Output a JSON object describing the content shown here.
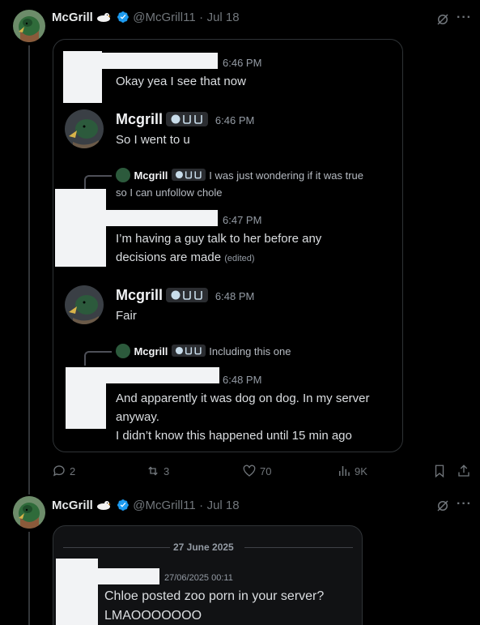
{
  "tweet1": {
    "author_name": "McGrill",
    "handle": "@McGrill11",
    "dot": "·",
    "date": "Jul 18",
    "stats": {
      "replies": "2",
      "reposts": "3",
      "likes": "70",
      "views": "9K"
    }
  },
  "discord": {
    "m1": {
      "time": "6:46 PM",
      "text": "Okay yea I see that now"
    },
    "m2": {
      "name": "Mcgrill",
      "time": "6:46 PM",
      "text": "So I went to u"
    },
    "r1": {
      "name": "Mcgrill",
      "text": "I was just wondering if it was true",
      "text2": "so I can unfollow chole"
    },
    "m3": {
      "time": "6:47 PM",
      "line1": "I’m having a guy talk to her before any",
      "line2": "decisions are made",
      "edited": "(edited)"
    },
    "m4": {
      "name": "Mcgrill",
      "time": "6:48 PM",
      "text": "Fair"
    },
    "r2": {
      "name": "Mcgrill",
      "text": "Including this one"
    },
    "m5": {
      "time": "6:48 PM",
      "line1": "And apparently it was dog on dog. In my server",
      "line2": "anyway.",
      "line3": "I didn’t know this happened until 15 min ago"
    }
  },
  "tweet2": {
    "author_name": "McGrill",
    "handle": "@McGrill11",
    "dot": "·",
    "date": "Jul 18",
    "date_divider": "27 June 2025",
    "msg_time": "27/06/2025 00:11",
    "line1": "Chloe posted zoo porn in your server?",
    "line2": "LMAOOOOOOO"
  },
  "colors": {
    "verified": "#1d9bf0",
    "bg": "#000000",
    "discord_bg": "#111214"
  }
}
